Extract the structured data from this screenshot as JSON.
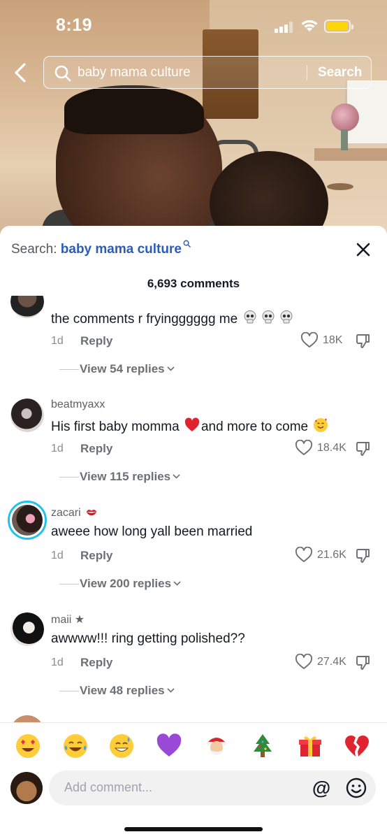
{
  "status_bar": {
    "time": "8:19"
  },
  "top_search": {
    "query": "baby mama culture",
    "search_label": "Search"
  },
  "sheet": {
    "search_prefix": "Search: ",
    "search_term": "baby mama culture",
    "comment_count": "6,693 comments"
  },
  "comments": [
    {
      "username": "",
      "text": "the comments r fryingggggg me",
      "text_emojis": [
        "skull",
        "skull",
        "skull"
      ],
      "age": "1d",
      "reply_label": "Reply",
      "likes": "18K",
      "view_replies": "View 54 replies"
    },
    {
      "username": "beatmyaxx",
      "text_before": "His first baby momma",
      "text_after": "and more to come",
      "text_emojis": [
        "red-heart",
        "smiling-face-with-hearts"
      ],
      "age": "1d",
      "reply_label": "Reply",
      "likes": "18.4K",
      "view_replies": "View 115 replies"
    },
    {
      "username": "zacari",
      "username_emoji": "kiss-mark",
      "text": "aweee how long yall been married",
      "age": "1d",
      "reply_label": "Reply",
      "likes": "21.6K",
      "view_replies": "View 200 replies"
    },
    {
      "username": "maii ★",
      "text": "awwww!!! ring getting polished??",
      "age": "1d",
      "reply_label": "Reply",
      "likes": "27.4K",
      "view_replies": "View 48 replies"
    }
  ],
  "emoji_bar": [
    "heart-eyes",
    "tears-of-joy",
    "grinning-sweat",
    "purple-heart",
    "santa",
    "christmas-tree",
    "gift",
    "broken-heart"
  ],
  "input": {
    "placeholder": "Add comment...",
    "at_label": "@"
  },
  "colors": {
    "accent_link": "#2b5db8",
    "story_ring": "#22c3e6",
    "battery": "#ffd60a"
  }
}
